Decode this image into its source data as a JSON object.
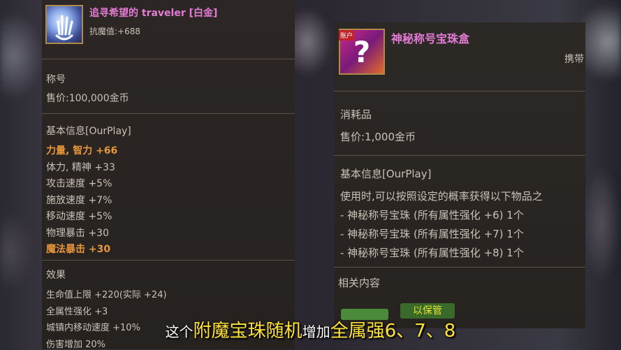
{
  "left_item": {
    "title": "追寻希望的 traveler [白金]",
    "stat": "抗魔值:+688",
    "type": "称号",
    "price": "售价:100,000金币",
    "basic_info": "基本信息[OurPlay]",
    "attrs": [
      {
        "text": "力量, 智力 +66",
        "highlight": true
      },
      {
        "text": "体力, 精神 +33",
        "highlight": false
      },
      {
        "text": "攻击速度 +5%",
        "highlight": false
      },
      {
        "text": "施放速度 +7%",
        "highlight": false
      },
      {
        "text": "移动速度 +5%",
        "highlight": false
      },
      {
        "text": "物理暴击 +30",
        "highlight": false
      },
      {
        "text": "魔法暴击 +30",
        "highlight": true
      }
    ],
    "effect_label": "效果",
    "effects": [
      "生命值上限 +220(实际 +24)",
      "全属性强化 +3",
      "城镇内移动速度 +10%",
      "伤害增加 20%"
    ]
  },
  "right_item": {
    "title": "神秘称号宝珠盒",
    "badge": "账户",
    "carry": "携带",
    "type": "消耗品",
    "price": "售价:1,000金币",
    "basic_info": "基本信息[OurPlay]",
    "desc": "使用时,可以按照设定的概率获得以下物品之",
    "rewards": [
      "- 神秘称号宝珠 (所有属性强化 +6) 1个",
      "- 神秘称号宝珠 (所有属性强化 +7) 1个",
      "- 神秘称号宝珠 (所有属性强化 +8) 1个"
    ],
    "related": "相关内容",
    "button_label": "以保管"
  },
  "subtitle": {
    "part1": "这个",
    "part2": "附魔宝珠随机",
    "part3": "增加",
    "part4": "全属强6、7、8"
  },
  "colors": {
    "orange": "#e8963c",
    "pink": "#e47cd6",
    "gold_border": "#b08a4a"
  }
}
